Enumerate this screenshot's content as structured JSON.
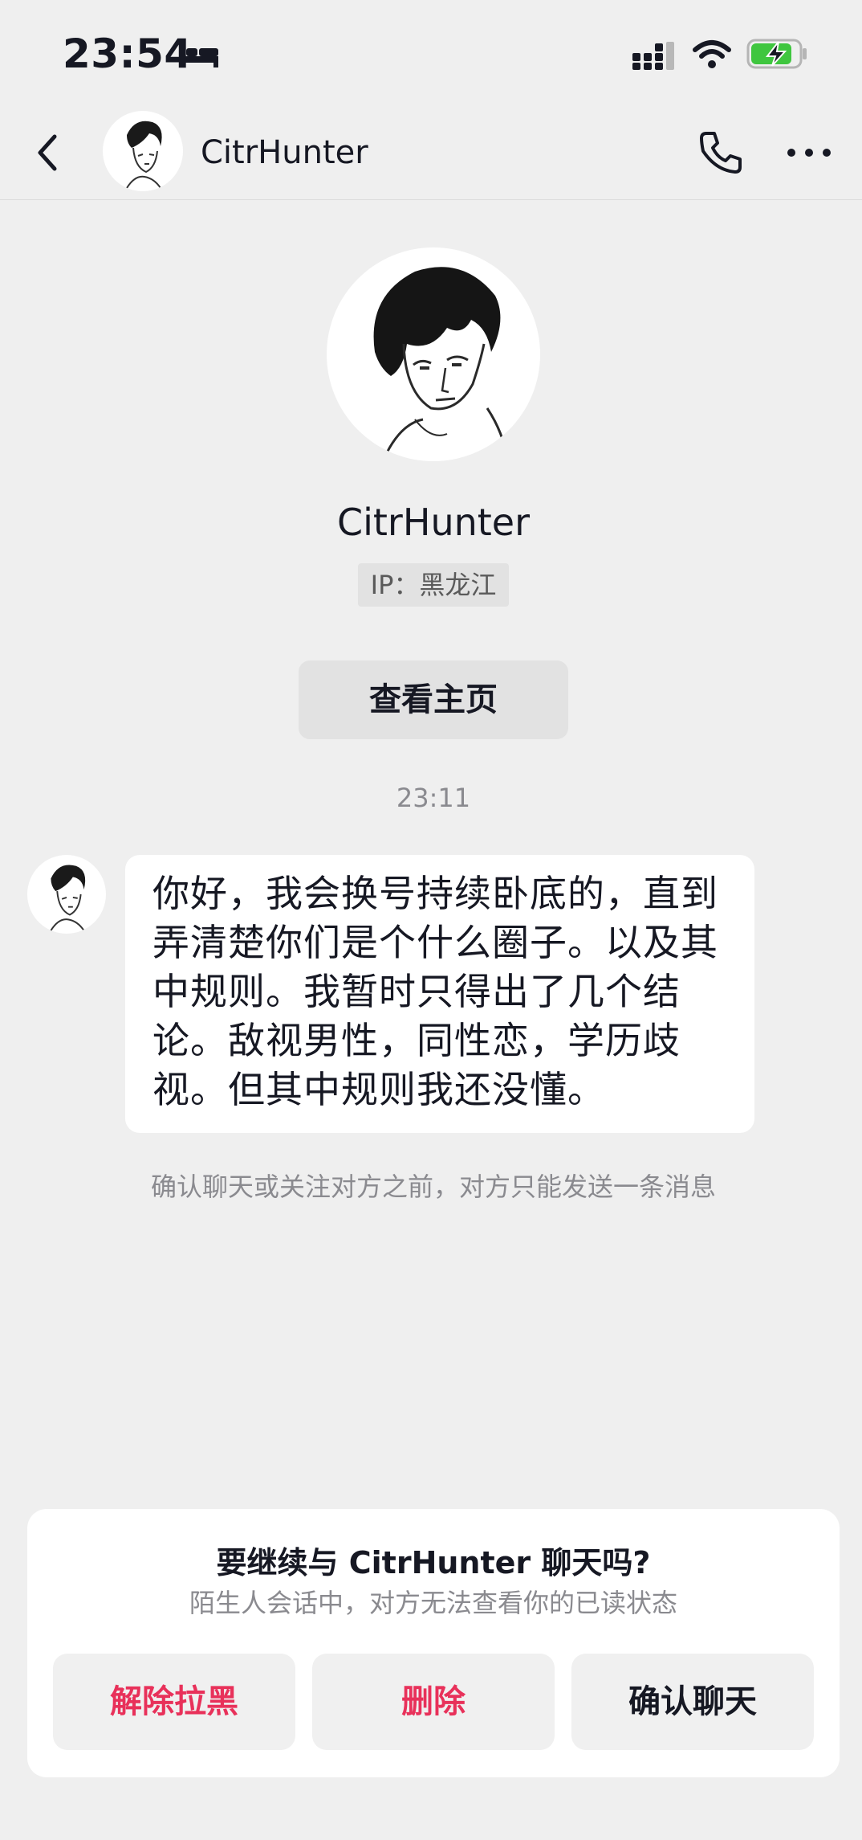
{
  "status_bar": {
    "time": "23:54",
    "icons": [
      "bed-icon",
      "signal-icon",
      "wifi-icon",
      "battery-charging-icon"
    ]
  },
  "header": {
    "name": "CitrHunter",
    "icons": [
      "back-icon",
      "avatar",
      "phone-icon",
      "more-icon"
    ]
  },
  "profile": {
    "name": "CitrHunter",
    "ip": "IP：黑龙江",
    "home_button": "查看主页"
  },
  "conversation": {
    "timestamp": "23:11",
    "message": "你好，我会换号持续卧底的，直到弄清楚你们是个什么圈子。以及其中规则。我暂时只得出了几个结论。敌视男性，同性恋，学历歧视。但其中规则我还没懂。",
    "notice": "确认聊天或关注对方之前，对方只能发送一条消息"
  },
  "stranger_card": {
    "title": "要继续与 CitrHunter 聊天吗?",
    "subtitle": "陌生人会话中，对方无法查看你的已读状态",
    "buttons": {
      "unblock": "解除拉黑",
      "delete": "删除",
      "confirm": "确认聊天"
    }
  },
  "colors": {
    "background": "#efefef",
    "danger": "#e8315a",
    "text": "#161823",
    "muted": "#8a8a8f",
    "battery": "#3fc63f"
  }
}
